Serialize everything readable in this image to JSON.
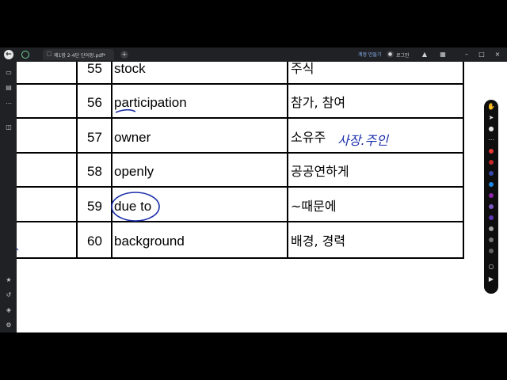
{
  "tab": {
    "title": "제1장 2-4단 단어장.pdf*"
  },
  "header": {
    "action_label": "계정 만들기",
    "login_label": "로그인"
  },
  "rows": [
    {
      "num": "55",
      "word": "stock",
      "meaning": "주식"
    },
    {
      "num": "56",
      "word": "participation",
      "meaning": "참가, 참여"
    },
    {
      "num": "57",
      "word": "owner",
      "meaning": "소유주"
    },
    {
      "num": "58",
      "word": "openly",
      "meaning": "공공연하게"
    },
    {
      "num": "59",
      "word": "due to",
      "meaning": "~때문에"
    },
    {
      "num": "60",
      "word": "background",
      "meaning": "배경, 경력"
    }
  ],
  "annotation": {
    "row57_note": "사장.주인"
  },
  "colors": {
    "ink": "#1a2ea8",
    "pen_colors": [
      "#e53935",
      "#c62828",
      "#3949ab",
      "#1e88e5",
      "#8e24aa",
      "#7e57c2",
      "#5e35b1",
      "#9e9e9e",
      "#757575",
      "#616161"
    ]
  }
}
